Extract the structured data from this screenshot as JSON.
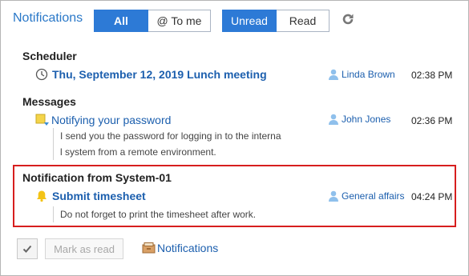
{
  "header": {
    "title": "Notifications",
    "filters": {
      "all": "All",
      "to_me": "@ To me"
    },
    "status": {
      "unread": "Unread",
      "read": "Read"
    }
  },
  "sections": [
    {
      "name": "Scheduler",
      "items": [
        {
          "title": "Thu, September 12, 2019 Lunch meeting",
          "user": "Linda Brown",
          "time": "02:38 PM",
          "description": []
        }
      ]
    },
    {
      "name": "Messages",
      "items": [
        {
          "title": "Notifying your password",
          "user": "John Jones",
          "time": "02:36 PM",
          "description": [
            "I send you the password for logging in to the interna",
            "l system from a remote environment."
          ]
        }
      ]
    },
    {
      "name": "Notification from System-01",
      "items": [
        {
          "title": "Submit timesheet",
          "user": "General affairs",
          "time": "04:24 PM",
          "description": [
            "Do not forget to print the timesheet after work."
          ]
        }
      ]
    }
  ],
  "footer": {
    "mark_as_read": "Mark as read",
    "notifications_link": "Notifications"
  },
  "colors": {
    "accent": "#2d7ad6",
    "link": "#1c5fae",
    "highlight_border": "#d71e1e"
  }
}
